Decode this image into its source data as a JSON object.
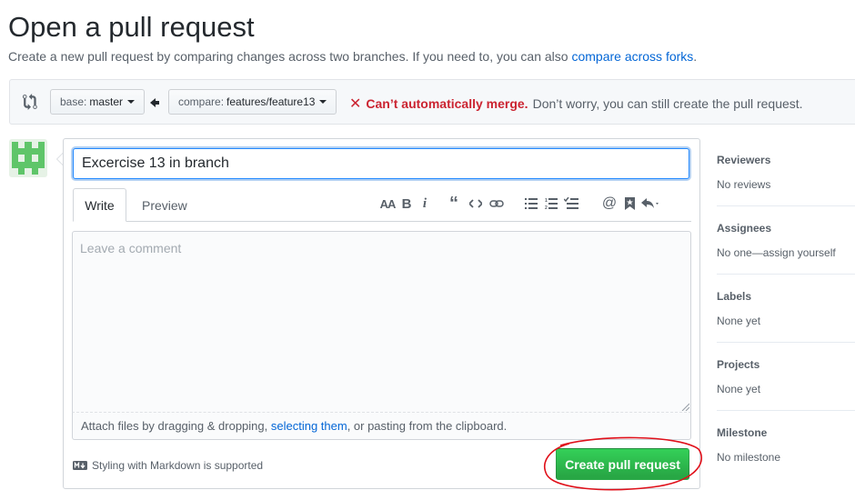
{
  "header": {
    "title": "Open a pull request",
    "subtitle_pre": "Create a new pull request by comparing changes across two branches. If you need to, you can also ",
    "subtitle_link": "compare across forks",
    "subtitle_post": "."
  },
  "range": {
    "base_label": "base:",
    "base_value": "master",
    "compare_label": "compare:",
    "compare_value": "features/feature13",
    "merge_error": "Can’t automatically merge.",
    "merge_message": "Don’t worry, you can still create the pull request."
  },
  "form": {
    "title_value": "Excercise 13 in branch",
    "tabs": [
      {
        "label": "Write",
        "active": true
      },
      {
        "label": "Preview",
        "active": false
      }
    ],
    "toolbar_icons": [
      "header-icon",
      "bold-icon",
      "italic-icon",
      "quote-icon",
      "code-icon",
      "link-icon",
      "unordered-list-icon",
      "ordered-list-icon",
      "task-list-icon",
      "mention-icon",
      "reference-icon",
      "reply-icon"
    ],
    "comment_placeholder": "Leave a comment",
    "attach_pre": "Attach files by dragging & dropping, ",
    "attach_link": "selecting them",
    "attach_post": ", or pasting from the clipboard.",
    "markdown_note": "Styling with Markdown is supported",
    "submit_label": "Create pull request"
  },
  "sidebar": {
    "sections": [
      {
        "title": "Reviewers",
        "value": "No reviews"
      },
      {
        "title": "Assignees",
        "value": "No one—assign yourself"
      },
      {
        "title": "Labels",
        "value": "None yet"
      },
      {
        "title": "Projects",
        "value": "None yet"
      },
      {
        "title": "Milestone",
        "value": "No milestone"
      }
    ]
  },
  "colors": {
    "primary_green": "#28a745",
    "error_red": "#cb2431",
    "link_blue": "#0366d6",
    "annotation_red": "#e0101a"
  }
}
